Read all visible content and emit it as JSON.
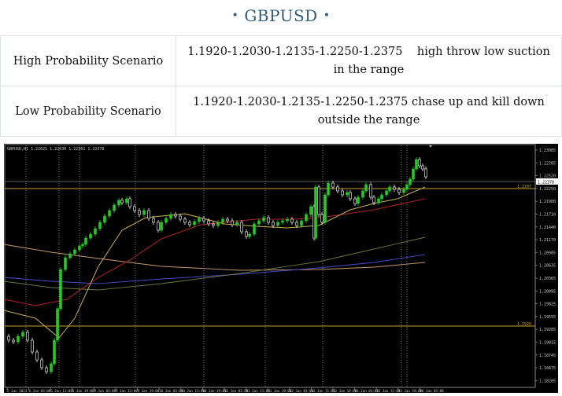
{
  "header": {
    "title": "GBPUSD"
  },
  "scenarios": [
    {
      "label": "High Probability Scenario",
      "value": "1.1920-1.2030-1.2135-1.2250-1.2375    high throw low suction in the range"
    },
    {
      "label": "Low Probability Scenario",
      "value": "1.1920-1.2030-1.2135-1.2250-1.2375 chase up and kill down outside the range"
    }
  ],
  "chart": {
    "symbol_label": "GBPUSD,H1  1.22621 1.22630 1.22361 1.22378",
    "price_ticks": [
      "1.23085",
      "1.22785",
      "1.22520",
      "1.22250",
      "1.21980",
      "1.21710",
      "1.21440",
      "1.21170",
      "1.20905",
      "1.20635",
      "1.20365",
      "1.20095",
      "1.19825",
      "1.19555",
      "1.19285",
      "1.19015",
      "1.18745",
      "1.18475",
      "1.18205"
    ],
    "current_price": "1.22378",
    "level_upper": "1.2207",
    "level_lower": "1.1920",
    "time_ticks": [
      "5 Jan 2023",
      "6 Jan 03:00",
      "6 Jan 11:00",
      "6 Jan 19:00",
      "9 Jan 03:00",
      "9 Jan 11:00",
      "9 Jan 19:00",
      "10 Jan 03:00",
      "10 Jan 11:00",
      "10 Jan 19:00",
      "11 Jan 03:00",
      "11 Jan 11:00",
      "11 Jan 19:00",
      "12 Jan 03:00",
      "12 Jan 11:00",
      "12 Jan 19:00",
      "13 Jan 03:00",
      "13 Jan 11:00",
      "13 Jan 19:00",
      "16 Jan 03:00"
    ],
    "colors": {
      "bg": "#000000",
      "bull": "#22cc22",
      "bear": "#ffffff",
      "grid": "#ffffff",
      "level": "#c8a22a"
    }
  }
}
